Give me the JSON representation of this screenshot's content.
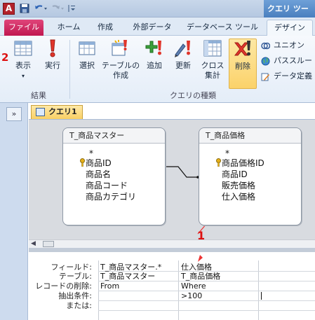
{
  "titlebar": {
    "app_icon_letter": "A",
    "contextual_title": "クエリ ツール"
  },
  "tabs": [
    "ファイル",
    "ホーム",
    "作成",
    "外部データ",
    "データベース ツール",
    "デザイン"
  ],
  "ribbon": {
    "results_group": {
      "label": "結果",
      "buttons": [
        {
          "label": "表示",
          "icon": "table-view-icon"
        },
        {
          "label": "実行",
          "icon": "run-exclamation-icon"
        }
      ]
    },
    "query_type_group": {
      "label": "クエリの種類",
      "buttons": [
        {
          "label": "選択",
          "icon": "select-query-icon"
        },
        {
          "label": "テーブルの\n作成",
          "icon": "make-table-icon"
        },
        {
          "label": "追加",
          "icon": "append-query-icon"
        },
        {
          "label": "更新",
          "icon": "update-query-icon"
        },
        {
          "label": "クロス\n集計",
          "icon": "crosstab-icon"
        },
        {
          "label": "削除",
          "icon": "delete-query-icon",
          "active": true
        }
      ],
      "small_buttons": [
        {
          "label": "ユニオン",
          "icon": "union-icon"
        },
        {
          "label": "パススルー",
          "icon": "globe-icon"
        },
        {
          "label": "データ定義",
          "icon": "data-definition-icon"
        }
      ]
    }
  },
  "annotations": {
    "num1": "1",
    "num2": "2"
  },
  "document": {
    "nav_toggle": "»",
    "tab_label": "クエリ1",
    "tables": [
      {
        "title": "T_商品マスター",
        "fields": [
          "*",
          "商品ID",
          "商品名",
          "商品コード",
          "商品カテゴリ"
        ]
      },
      {
        "title": "T_商品価格",
        "fields": [
          "*",
          "商品価格ID",
          "商品ID",
          "販売価格",
          "仕入価格"
        ]
      }
    ]
  },
  "grid": {
    "row_labels": [
      "フィールド:",
      "テーブル:",
      "レコードの削除:",
      "抽出条件:",
      "または:"
    ],
    "columns": [
      {
        "field": "T_商品マスター.*",
        "table": "T_商品マスター",
        "delete": "From",
        "criteria": "",
        "or": ""
      },
      {
        "field": "仕入価格",
        "table": "T_商品価格",
        "delete": "Where",
        "criteria": ">100",
        "or": ""
      }
    ]
  },
  "colors": {
    "file_tab": "#c01750",
    "active_button": "#fbd26a",
    "annotation_red": "#dd1111"
  }
}
